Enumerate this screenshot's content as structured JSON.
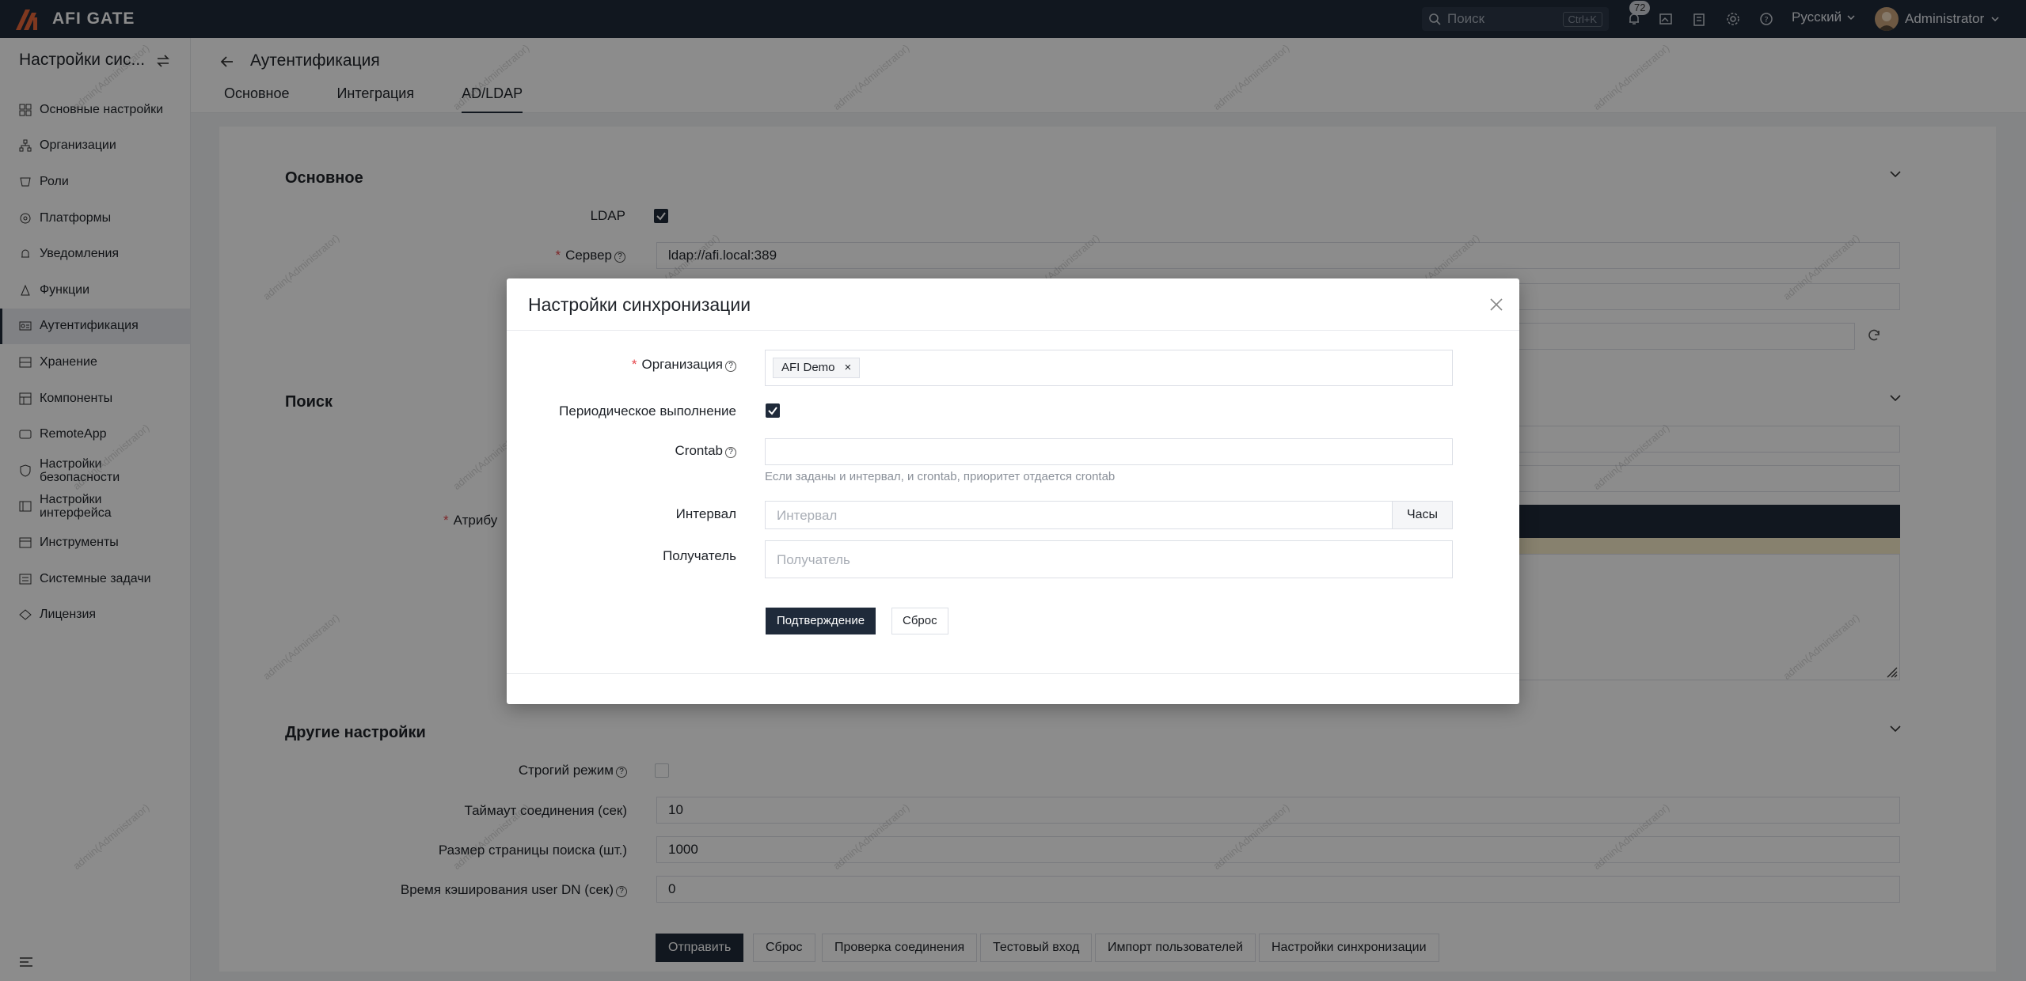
{
  "topbar": {
    "logo": "AFI GATE",
    "search_placeholder": "Поиск",
    "search_shortcut": "Ctrl+K",
    "notifications_count": "72",
    "language": "Русский",
    "user": "Administrator"
  },
  "sidebar": {
    "title": "Настройки сис...",
    "items": [
      {
        "label": "Основные настройки",
        "icon": "grid-icon"
      },
      {
        "label": "Организации",
        "icon": "org-icon"
      },
      {
        "label": "Роли",
        "icon": "role-icon"
      },
      {
        "label": "Платформы",
        "icon": "platform-icon"
      },
      {
        "label": "Уведомления",
        "icon": "bell-icon"
      },
      {
        "label": "Функции",
        "icon": "function-icon"
      },
      {
        "label": "Аутентификация",
        "icon": "auth-icon",
        "active": true
      },
      {
        "label": "Хранение",
        "icon": "storage-icon"
      },
      {
        "label": "Компоненты",
        "icon": "components-icon"
      },
      {
        "label": "RemoteApp",
        "icon": "remoteapp-icon"
      },
      {
        "label": "Настройки безопасности",
        "icon": "security-icon"
      },
      {
        "label": "Настройки интерфейса",
        "icon": "interface-icon"
      },
      {
        "label": "Инструменты",
        "icon": "tools-icon"
      },
      {
        "label": "Системные задачи",
        "icon": "tasks-icon"
      },
      {
        "label": "Лицензия",
        "icon": "license-icon"
      }
    ]
  },
  "header": {
    "title": "Аутентификация",
    "tabs": [
      "Основное",
      "Интеграция",
      "AD/LDAP"
    ],
    "active_tab": "AD/LDAP"
  },
  "form": {
    "section_basic": "Основное",
    "ldap_label": "LDAP",
    "server_label": "Сервер",
    "server_value": "ldap://afi.local:389",
    "section_search": "Поиск",
    "attr_label_partial": "Атрибу",
    "section_other": "Другие настройки",
    "strict_label": "Строгий режим",
    "timeout_label": "Таймаут соединения (сек)",
    "timeout_value": "10",
    "page_size_label": "Размер страницы поиска (шт.)",
    "page_size_value": "1000",
    "cache_label": "Время кэширования user DN (сек)",
    "cache_value": "0",
    "buttons": {
      "submit": "Отправить",
      "reset": "Сброс",
      "test_connection": "Проверка соединения",
      "test_login": "Тестовый вход",
      "import_users": "Импорт пользователей",
      "sync_settings": "Настройки синхронизации"
    }
  },
  "modal": {
    "title": "Настройки синхронизации",
    "org_label": "Организация",
    "org_tag": "AFI Demo",
    "periodic_label": "Периодическое выполнение",
    "crontab_label": "Crontab",
    "crontab_hint": "Если заданы и интервал, и crontab, приоритет отдается crontab",
    "interval_label": "Интервал",
    "interval_placeholder": "Интервал",
    "interval_suffix": "Часы",
    "recipient_label": "Получатель",
    "recipient_placeholder": "Получатель",
    "confirm": "Подтверждение",
    "reset": "Сброс"
  },
  "watermark": "admin(Administrator)",
  "colors": {
    "navbar": "#1f2a3a",
    "primary": "#1f2a3a",
    "required": "#e5484d"
  }
}
